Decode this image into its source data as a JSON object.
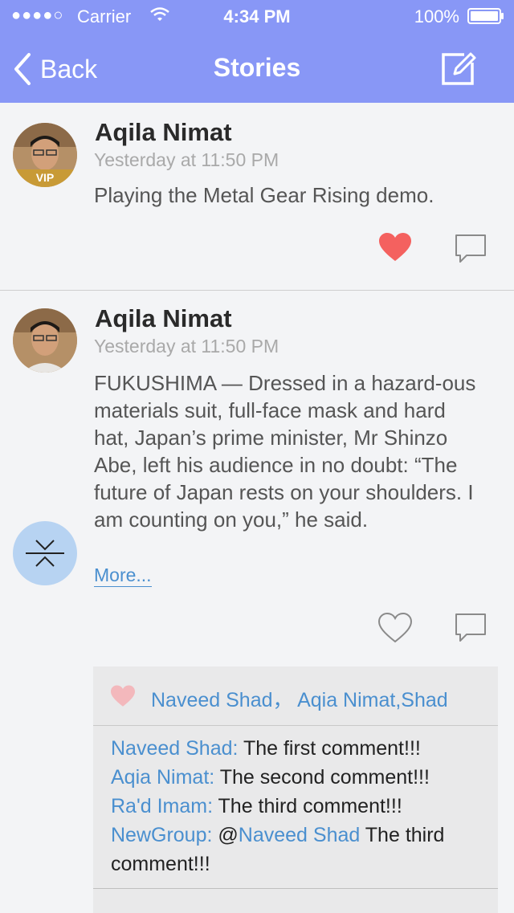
{
  "status_bar": {
    "signal": "●●●●○",
    "carrier": "Carrier",
    "time": "4:34 PM",
    "battery": "100%"
  },
  "nav": {
    "back_label": "Back",
    "title": "Stories"
  },
  "posts": [
    {
      "author": "Aqila Nimat",
      "time": "Yesterday at 11:50 PM",
      "text": "Playing the Metal Gear Rising demo.",
      "vip": "VIP",
      "liked": true
    },
    {
      "author": "Aqila Nimat",
      "time": "Yesterday at 11:50 PM",
      "text": "FUKUSHIMA — Dressed in a hazard-ous materials suit, full-face mask and hard hat, Japan’s prime minister, Mr Shinzo Abe, left his audience in no doubt: “The future of Japan rests on your shoulders. I am counting on you,” he said.",
      "more_label": "More...",
      "liked": false
    }
  ],
  "likes": {
    "names": "Naveed Shad， Aqia Nimat,Shad"
  },
  "comments": [
    {
      "name": "Naveed Shad:",
      "text": " The first comment!!!"
    },
    {
      "name": "Aqia Nimat:",
      "text": " The second comment!!!"
    },
    {
      "name": "Ra'd Imam:",
      "text": " The third comment!!!"
    },
    {
      "name": "NewGroup:",
      "mention_prefix": " @",
      "mention": "Naveed Shad",
      "text": " The third comment!!!"
    }
  ],
  "colors": {
    "header": "#8897f6",
    "like_active": "#f4615f",
    "link": "#4a8fcf"
  },
  "icons": {
    "back": "chevron-left-icon",
    "compose": "compose-icon",
    "like": "heart-icon",
    "comment": "comment-bubble-icon",
    "collapse": "collapse-icon"
  }
}
